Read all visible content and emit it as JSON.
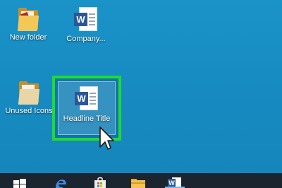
{
  "desktop": {
    "background_color": "#178cc2",
    "icons": [
      {
        "label": "New folder",
        "icon": "folder-icon"
      },
      {
        "label": "Company...",
        "icon": "word-document-icon"
      },
      {
        "label": "Unused Icons",
        "icon": "folder-icon"
      },
      {
        "label": "Headline Title",
        "icon": "word-document-icon",
        "selected": true
      }
    ],
    "highlight_color": "#1ddc2e"
  },
  "word_badge": "W",
  "taskbar": {
    "background_color": "#1b2530",
    "items": [
      {
        "name": "start",
        "icon": "windows-logo-icon"
      },
      {
        "name": "edge",
        "icon": "edge-browser-icon"
      },
      {
        "name": "store",
        "icon": "store-bag-icon"
      },
      {
        "name": "file-explorer",
        "icon": "folder-icon"
      },
      {
        "name": "word",
        "icon": "word-icon",
        "active": true
      }
    ]
  }
}
